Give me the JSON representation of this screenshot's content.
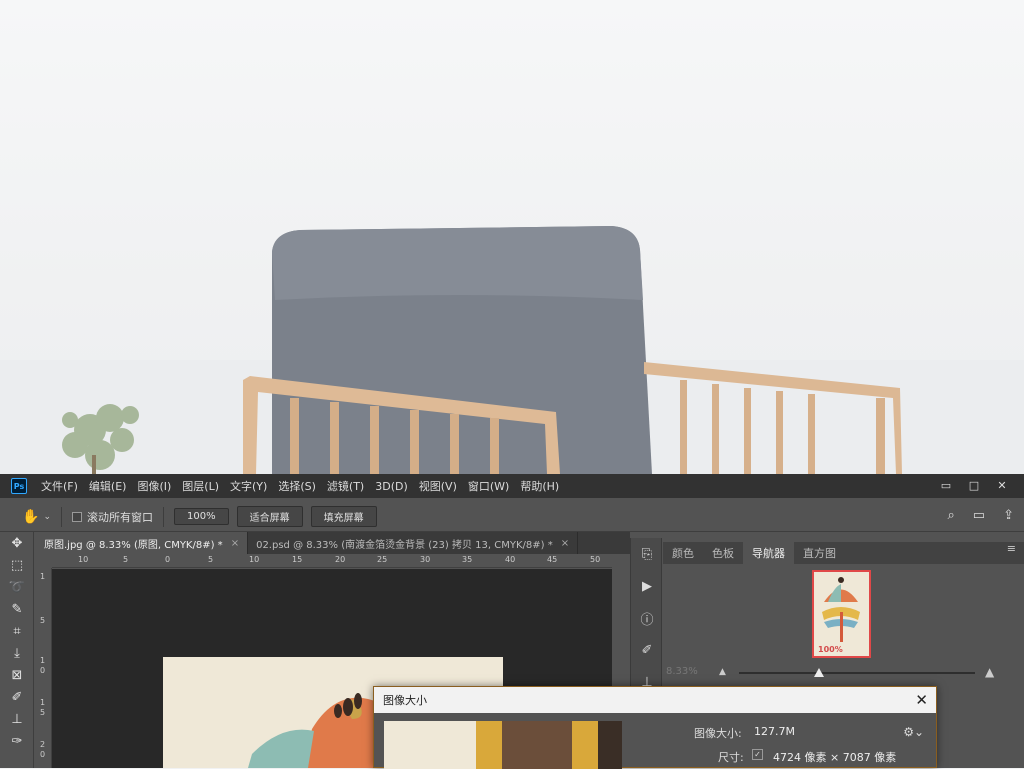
{
  "app": {
    "logo": "Ps"
  },
  "menubar": {
    "items": [
      "文件(F)",
      "编辑(E)",
      "图像(I)",
      "图层(L)",
      "文字(Y)",
      "选择(S)",
      "滤镜(T)",
      "3D(D)",
      "视图(V)",
      "窗口(W)",
      "帮助(H)"
    ]
  },
  "window_controls": {
    "minimize": "▭",
    "restore": "□",
    "close": "✕"
  },
  "options": {
    "scroll_all_label": "滚动所有窗口",
    "zoom_value": "100%",
    "fit_screen": "适合屏幕",
    "fill_screen": "填充屏幕"
  },
  "doc_tabs": [
    {
      "label": "原图.jpg @ 8.33% (原图, CMYK/8#) *",
      "close": "×"
    },
    {
      "label": "02.psd @ 8.33% (南渡金箔烫金背景 (23) 拷贝 13, CMYK/8#) *",
      "close": "×"
    }
  ],
  "ruler_h": [
    "10",
    "5",
    "0",
    "5",
    "10",
    "15",
    "20",
    "25",
    "30",
    "35",
    "40",
    "45",
    "50"
  ],
  "ruler_v": [
    "1",
    "5",
    "1",
    "0",
    "1",
    "5",
    "2",
    "0"
  ],
  "panel_tabs": [
    "颜色",
    "色板",
    "导航器",
    "直方图"
  ],
  "navigator": {
    "thumb_zoom": "100%",
    "zoom_percent": "8.33%"
  },
  "dialog": {
    "title": "图像大小",
    "size_label": "图像大小:",
    "size_value": "127.7M",
    "dims_label": "尺寸:",
    "dims_value": "4724 像素 × 7087 像素"
  },
  "colors": {
    "ps_bg": "#535353",
    "menubar": "#323232",
    "dialog_border": "#8a5e1f",
    "thumb_border": "#e04848"
  }
}
